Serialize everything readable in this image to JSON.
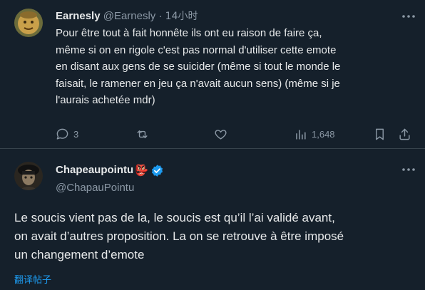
{
  "post1": {
    "author_name": "Earnesly",
    "author_handle": "@Earnesly",
    "separator": "·",
    "time": "14小时",
    "text_lines": [
      "Pour être tout à fait honnête ils ont eu raison de faire ça,",
      "même si on en rigole c'est pas normal d'utiliser cette emote",
      "en disant aux gens de se suicider (même si tout le monde le",
      "faisait, le ramener en jeu ça n'avait aucun sens) (même si je",
      "l'aurais achetée mdr)"
    ],
    "actions": {
      "reply_count": "3",
      "views_count": "1,648"
    }
  },
  "post2": {
    "author_name": "Chapeaupointu",
    "author_emoji": "👺",
    "author_handle": "@ChapauPointu",
    "text_lines": [
      "Le soucis vient pas de la, le soucis est qu’il l’ai validé avant,",
      "on avait d’autres proposition. La on se retrouve à être imposé",
      "un changement d’emote"
    ],
    "translate_label": "翻译帖子"
  },
  "colors": {
    "background": "#15202b",
    "text": "#e7e9ea",
    "muted": "#8b98a5",
    "accent": "#1d9bf0",
    "divider": "#38444d"
  },
  "icons": [
    "more-icon",
    "reply-icon",
    "retweet-icon",
    "like-icon",
    "views-icon",
    "bookmark-icon",
    "share-icon",
    "verified-badge-icon"
  ]
}
